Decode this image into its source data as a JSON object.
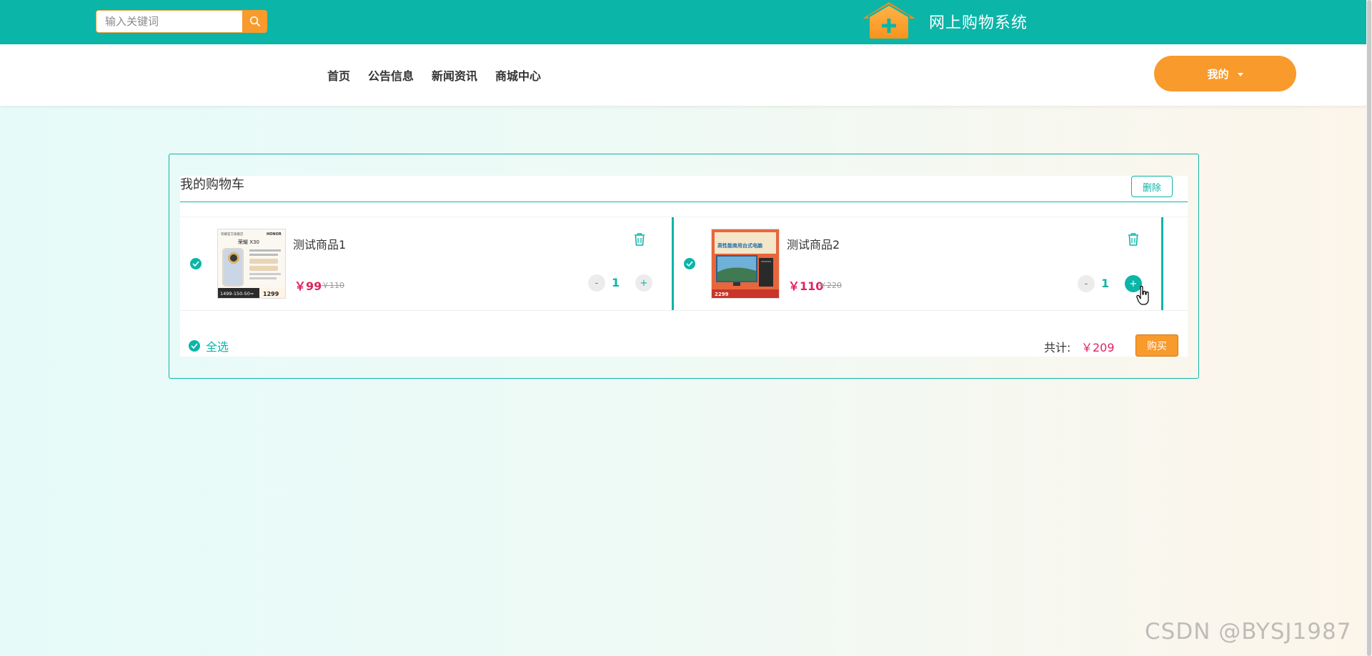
{
  "header": {
    "search_placeholder": "输入关键词",
    "site_title": "网上购物系统"
  },
  "nav": {
    "items": [
      {
        "label": "首页"
      },
      {
        "label": "公告信息"
      },
      {
        "label": "新闻资讯"
      },
      {
        "label": "商城中心"
      }
    ],
    "mine_label": "我的"
  },
  "cart": {
    "title": "我的购物车",
    "delete_label": "删除",
    "items": [
      {
        "name": "测试商品1",
        "price": "￥99",
        "original_price": "￥110",
        "quantity": "1",
        "minus": "-",
        "plus": "+",
        "thumb": {
          "brand": "HONOR",
          "model": "荣耀 X30",
          "promo_left": "1499-150-50=",
          "promo_right": "1299"
        }
      },
      {
        "name": "测试商品2",
        "price": "￥110",
        "original_price": "￥220",
        "quantity": "1",
        "minus": "-",
        "plus": "+",
        "thumb": {
          "headline": "高性能商用台式电脑",
          "price_tag": "2299"
        }
      }
    ],
    "select_all_label": "全选",
    "total_label": "共计:",
    "total_value": "￥209",
    "buy_label": "购买"
  },
  "watermark": "CSDN @BYSJ1987",
  "colors": {
    "primary": "#0bb5a8",
    "accent": "#f89a2c",
    "price": "#e0245e"
  },
  "icons": [
    "search-icon",
    "house-logo-icon",
    "caret-down-icon",
    "check-circle-icon",
    "trash-icon",
    "hand-cursor-icon"
  ]
}
